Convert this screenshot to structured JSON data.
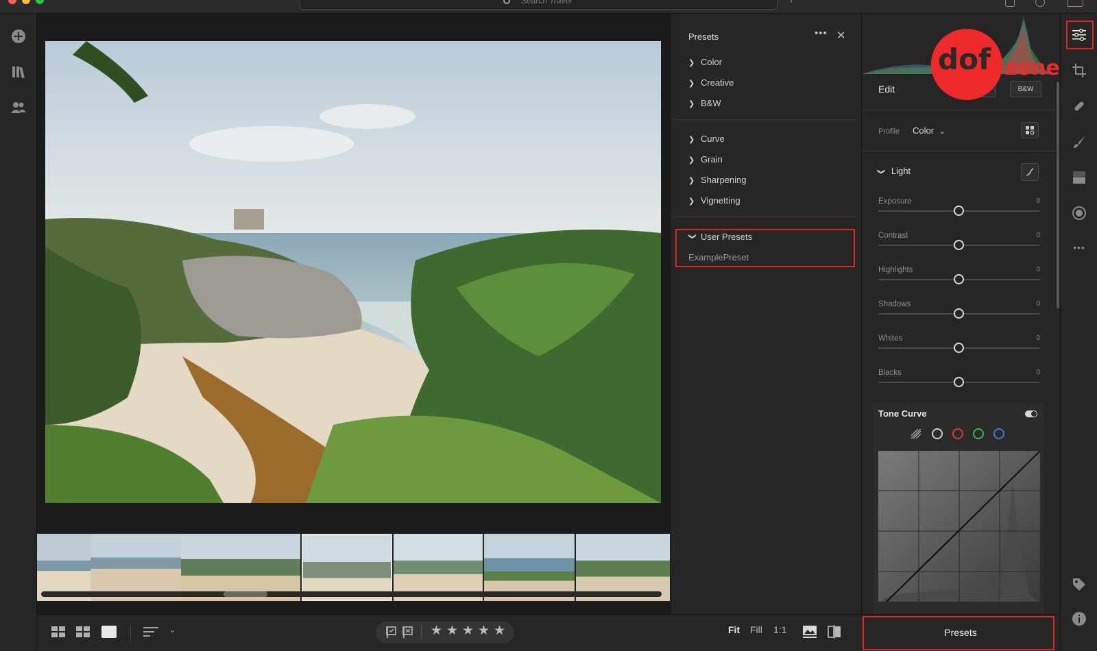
{
  "topbar": {
    "search_placeholder": "Search Travel"
  },
  "presets_panel": {
    "title": "Presets",
    "groups_a": [
      "Color",
      "Creative",
      "B&W"
    ],
    "groups_b": [
      "Curve",
      "Grain",
      "Sharpening",
      "Vignetting"
    ],
    "user_presets_label": "User Presets",
    "user_preset_item": "ExamplePreset"
  },
  "edit_panel": {
    "title": "Edit",
    "bw_button": "B&W",
    "profile_label": "Profile",
    "profile_value": "Color",
    "light_section": "Light",
    "sliders": [
      {
        "name": "Exposure",
        "value": "0"
      },
      {
        "name": "Contrast",
        "value": "0"
      },
      {
        "name": "Highlights",
        "value": "0"
      },
      {
        "name": "Shadows",
        "value": "0"
      },
      {
        "name": "Whites",
        "value": "0"
      },
      {
        "name": "Blacks",
        "value": "0"
      }
    ],
    "tone_curve_title": "Tone Curve",
    "presets_button": "Presets"
  },
  "bottombar": {
    "fit": "Fit",
    "fill": "Fill",
    "one_to_one": "1:1",
    "stars": [
      "★",
      "★",
      "★",
      "★",
      "★"
    ]
  },
  "watermark": {
    "brand_a": "dof",
    "brand_b": "zone"
  },
  "colors": {
    "highlight": "#e0262a",
    "panel": "#262626",
    "background": "#1b1b1b"
  }
}
